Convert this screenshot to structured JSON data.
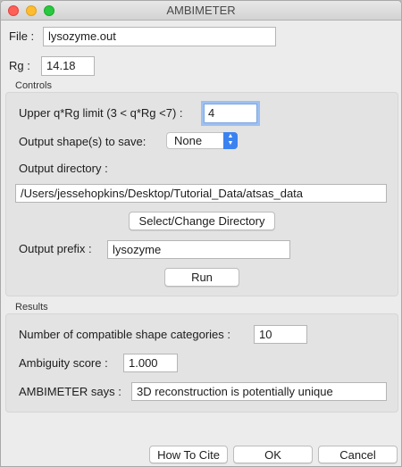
{
  "window": {
    "title": "AMBIMETER"
  },
  "file": {
    "label": "File :",
    "value": "lysozyme.out"
  },
  "rg": {
    "label": "Rg :",
    "value": "14.18"
  },
  "controls": {
    "title": "Controls",
    "upper_limit_label": "Upper q*Rg limit (3 < q*Rg <7) :",
    "upper_limit_value": "4",
    "output_shape_label": "Output shape(s) to save:",
    "output_shape_value": "None",
    "output_dir_label": "Output directory :",
    "output_dir_value": "/Users/jessehopkins/Desktop/Tutorial_Data/atsas_data",
    "select_dir_button": "Select/Change Directory",
    "output_prefix_label": "Output prefix :",
    "output_prefix_value": "lysozyme",
    "run_button": "Run"
  },
  "results": {
    "title": "Results",
    "categories_label": "Number of compatible shape categories :",
    "categories_value": "10",
    "ambiguity_label": "Ambiguity score :",
    "ambiguity_value": "1.000",
    "says_label": "AMBIMETER says :",
    "says_value": "3D reconstruction is potentially unique"
  },
  "footer": {
    "cite_button": "How To Cite",
    "ok_button": "OK",
    "cancel_button": "Cancel"
  },
  "colors": {
    "close": "#fe5f57",
    "minimize": "#febc2e",
    "maximize": "#28c840",
    "accent": "#3b82f1"
  }
}
